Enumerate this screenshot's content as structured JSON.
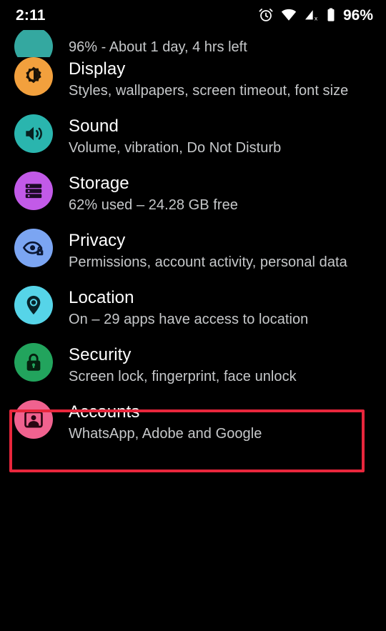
{
  "status_bar": {
    "clock": "2:11",
    "battery_percent": "96%",
    "icons": [
      "alarm-icon",
      "wifi-icon",
      "mobile-signal-off-icon",
      "battery-icon"
    ]
  },
  "screen": {
    "background_color": "#000000",
    "highlight_color": "#e8263c"
  },
  "partial_row": {
    "summary": "96% - About 1 day, 4 hrs left",
    "icon_name": "battery-icon",
    "icon_color": "#34a8a0"
  },
  "settings": [
    {
      "title": "Display",
      "summary": "Styles, wallpapers, screen timeout, font size",
      "icon_name": "brightness-icon",
      "icon_color": "#f2a03d",
      "key": "display"
    },
    {
      "title": "Sound",
      "summary": "Volume, vibration, Do Not Disturb",
      "icon_name": "speaker-icon",
      "icon_color": "#2ab5ae",
      "key": "sound"
    },
    {
      "title": "Storage",
      "summary": "62% used – 24.28 GB free",
      "icon_name": "storage-icon",
      "icon_color": "#c25ae8",
      "key": "storage"
    },
    {
      "title": "Privacy",
      "summary": "Permissions, account activity, personal data",
      "icon_name": "eye-lock-icon",
      "icon_color": "#7ba5f2",
      "key": "privacy"
    },
    {
      "title": "Location",
      "summary": "On – 29 apps have access to location",
      "icon_name": "map-pin-icon",
      "icon_color": "#56d4e8",
      "key": "location",
      "highlighted": true
    },
    {
      "title": "Security",
      "summary": "Screen lock, fingerprint, face unlock",
      "icon_name": "lock-icon",
      "icon_color": "#22a45d",
      "key": "security"
    },
    {
      "title": "Accounts",
      "summary": "WhatsApp, Adobe and Google",
      "icon_name": "account-card-icon",
      "icon_color": "#f0628f",
      "key": "accounts"
    }
  ]
}
